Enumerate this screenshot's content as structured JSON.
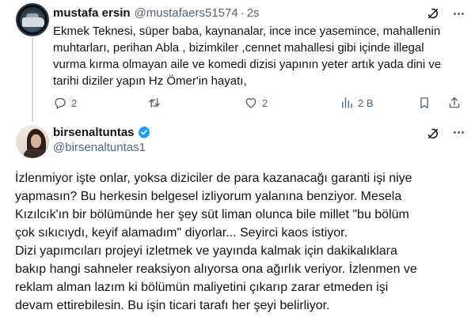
{
  "tweets": [
    {
      "author_name": "mustafa ersin",
      "handle": "@mustafaers51574",
      "separator": "·",
      "time": "2s",
      "text_lines": [
        "Ekmek Teknesi, süper baba, kaynanalar, ince ince yasemince, mahallenin",
        "muhtarları, perihan Abla , bizimkiler  ,cennet mahallesi gibi içinde illegal",
        "vurma kırma  olmayan aile ve komedi dizisi yapının yeter artık yada dini ve",
        "tarihi diziler yapın Hz Ömer'in hayatı,"
      ],
      "actions": {
        "replies": "2",
        "retweets": "",
        "likes": "2",
        "views": "2 B"
      },
      "avatar_icon": "car-profile-avatar"
    },
    {
      "author_name": "birsenaltuntas",
      "verified": true,
      "handle": "@birsenaltuntas1",
      "text_lines": [
        "İzlenmiyor işte onlar, yoksa diziciler de para kazanacağı garanti işi niye",
        "yapmasın? Bu herkesin belgesel izliyorum yalanına benziyor. Mesela",
        "Kızılcık'ın bir bölümünde her şey süt liman olunca bile millet \"bu bölüm",
        "çok sıkıcıydı, keyif alamadım\" diyorlar... Seyirci kaos istiyor.",
        "Dizi yapımcıları projeyi izletmek ve yayında kalmak için dakikalıklara",
        "bakıp hangi sahneler reaksiyon alıyorsa ona ağırlık veriyor. İzlenmen ve",
        "reklam alman lazım ki bölümün maliyetini çıkarıp zarar etmeden işi",
        "devam ettirebilesin. Bu işin ticari tarafı her şeyi belirliyor."
      ],
      "avatar_icon": "woman-profile-avatar"
    }
  ],
  "colors": {
    "text": "#0f1419",
    "secondary": "#536471",
    "verified": "#1d9bf0",
    "thread_line": "#cfd9de"
  }
}
